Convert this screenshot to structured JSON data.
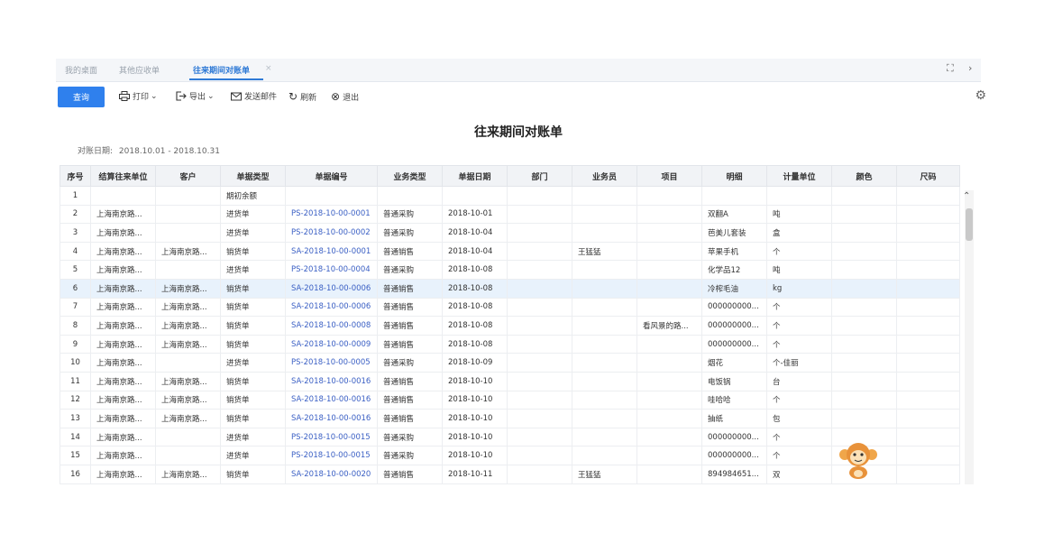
{
  "tabs": [
    {
      "label": "我的桌面"
    },
    {
      "label": "其他应收单"
    },
    {
      "label": "往来期间对账单",
      "active": true
    }
  ],
  "tab_close_glyph": "×",
  "window_controls": {
    "fullscreen": "⛶",
    "more": "›"
  },
  "toolbar": {
    "query_label": "查询",
    "print_label": "打印",
    "export_label": "导出",
    "email_label": "发送邮件",
    "refresh_label": "刷新",
    "exit_label": "退出"
  },
  "report": {
    "title": "往来期间对账单",
    "date_label": "对账日期:",
    "date_value": "2018.10.01 - 2018.10.31"
  },
  "columns": [
    "序号",
    "结算往来单位",
    "客户",
    "单据类型",
    "单据编号",
    "业务类型",
    "单据日期",
    "部门",
    "业务员",
    "项目",
    "明细",
    "计量单位",
    "颜色",
    "尺码"
  ],
  "rows": [
    [
      "1",
      "",
      "",
      "期初余额",
      "",
      "",
      "",
      "",
      "",
      "",
      "",
      "",
      "",
      ""
    ],
    [
      "2",
      "上海南京路...",
      "",
      "进货单",
      "PS-2018-10-00-0001",
      "普通采购",
      "2018-10-01",
      "",
      "",
      "",
      "双翻A",
      "吨",
      "",
      ""
    ],
    [
      "3",
      "上海南京路...",
      "",
      "进货单",
      "PS-2018-10-00-0002",
      "普通采购",
      "2018-10-04",
      "",
      "",
      "",
      "芭美儿套装",
      "盒",
      "",
      ""
    ],
    [
      "4",
      "上海南京路...",
      "上海南京路...",
      "销货单",
      "SA-2018-10-00-0001",
      "普通销售",
      "2018-10-04",
      "",
      "王猛猛",
      "",
      "苹果手机",
      "个",
      "",
      ""
    ],
    [
      "5",
      "上海南京路...",
      "",
      "进货单",
      "PS-2018-10-00-0004",
      "普通采购",
      "2018-10-08",
      "",
      "",
      "",
      "化学品12",
      "吨",
      "",
      ""
    ],
    [
      "6",
      "上海南京路...",
      "上海南京路...",
      "销货单",
      "SA-2018-10-00-0006",
      "普通销售",
      "2018-10-08",
      "",
      "",
      "",
      "冷榨毛油",
      "kg",
      "",
      ""
    ],
    [
      "7",
      "上海南京路...",
      "上海南京路...",
      "销货单",
      "SA-2018-10-00-0006",
      "普通销售",
      "2018-10-08",
      "",
      "",
      "",
      "000000000...",
      "个",
      "",
      ""
    ],
    [
      "8",
      "上海南京路...",
      "上海南京路...",
      "销货单",
      "SA-2018-10-00-0008",
      "普通销售",
      "2018-10-08",
      "",
      "",
      "看风景的路...",
      "000000000...",
      "个",
      "",
      ""
    ],
    [
      "9",
      "上海南京路...",
      "上海南京路...",
      "销货单",
      "SA-2018-10-00-0009",
      "普通销售",
      "2018-10-08",
      "",
      "",
      "",
      "000000000...",
      "个",
      "",
      ""
    ],
    [
      "10",
      "上海南京路...",
      "",
      "进货单",
      "PS-2018-10-00-0005",
      "普通采购",
      "2018-10-09",
      "",
      "",
      "",
      "烟花",
      "个-佳丽",
      "",
      ""
    ],
    [
      "11",
      "上海南京路...",
      "上海南京路...",
      "销货单",
      "SA-2018-10-00-0016",
      "普通销售",
      "2018-10-10",
      "",
      "",
      "",
      "电饭锅",
      "台",
      "",
      ""
    ],
    [
      "12",
      "上海南京路...",
      "上海南京路...",
      "销货单",
      "SA-2018-10-00-0016",
      "普通销售",
      "2018-10-10",
      "",
      "",
      "",
      "哇哈哈",
      "个",
      "",
      ""
    ],
    [
      "13",
      "上海南京路...",
      "上海南京路...",
      "销货单",
      "SA-2018-10-00-0016",
      "普通销售",
      "2018-10-10",
      "",
      "",
      "",
      "抽纸",
      "包",
      "",
      ""
    ],
    [
      "14",
      "上海南京路...",
      "",
      "进货单",
      "PS-2018-10-00-0015",
      "普通采购",
      "2018-10-10",
      "",
      "",
      "",
      "000000000...",
      "个",
      "",
      ""
    ],
    [
      "15",
      "上海南京路...",
      "",
      "进货单",
      "PS-2018-10-00-0015",
      "普通采购",
      "2018-10-10",
      "",
      "",
      "",
      "000000000...",
      "个",
      "",
      ""
    ],
    [
      "16",
      "上海南京路...",
      "上海南京路...",
      "销货单",
      "SA-2018-10-00-0020",
      "普通销售",
      "2018-10-11",
      "",
      "王猛猛",
      "",
      "894984651...",
      "双",
      "",
      ""
    ]
  ],
  "highlighted_row": 6,
  "icons": [
    "print-icon",
    "export-icon",
    "email-icon",
    "refresh-icon",
    "exit-icon",
    "settings-icon",
    "monkey-mascot-icon"
  ],
  "colors": {
    "accent": "#2f80ed",
    "link": "#3a5fc4",
    "highlight": "#e8f2fc"
  }
}
